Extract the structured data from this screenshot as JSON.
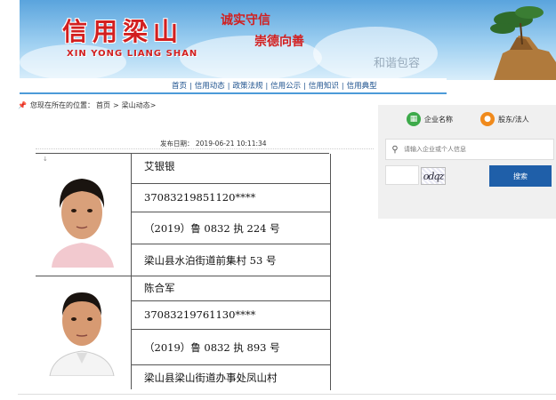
{
  "banner": {
    "logo_cn": "信用梁山",
    "logo_en": "XIN YONG LIANG SHAN",
    "slogan_1": "诚实守信",
    "slogan_2": "崇德向善",
    "watermark": "和谐包容"
  },
  "nav": {
    "items": [
      {
        "label": "首页"
      },
      {
        "label": "信用动态"
      },
      {
        "label": "政策法规"
      },
      {
        "label": "信用公示"
      },
      {
        "label": "信用知识"
      },
      {
        "label": "信用典型"
      }
    ]
  },
  "breadcrumb": {
    "prefix": "您现在所在的位置：",
    "home": "首页",
    "sep": ">",
    "section": "梁山动态",
    "end": ">"
  },
  "article": {
    "publish_label": "发布日期：",
    "publish_date": "2019-06-21 10:11:34"
  },
  "records": [
    {
      "name": "艾银银",
      "id_number": "37083219851120****",
      "case_number": "（2019）鲁 0832 执 224 号",
      "address": "梁山县水泊街道前集村 53 号"
    },
    {
      "name": "陈合军",
      "id_number": "37083219761130****",
      "case_number": "（2019）鲁 0832 执 893 号",
      "address": "梁山县梁山街道办事处凤山村"
    }
  ],
  "side_panel": {
    "tab_company": "企业名称",
    "tab_shareholder": "股东/法人",
    "search_placeholder": "请输入企业或个人信息",
    "captcha_text": "odqz",
    "search_button": "搜索"
  },
  "colors": {
    "brand_red": "#d21f1f",
    "nav_blue": "#1a4f8c",
    "button_blue": "#1f5fa9",
    "green_icon": "#3daa4a",
    "orange_icon": "#f08a1c"
  }
}
